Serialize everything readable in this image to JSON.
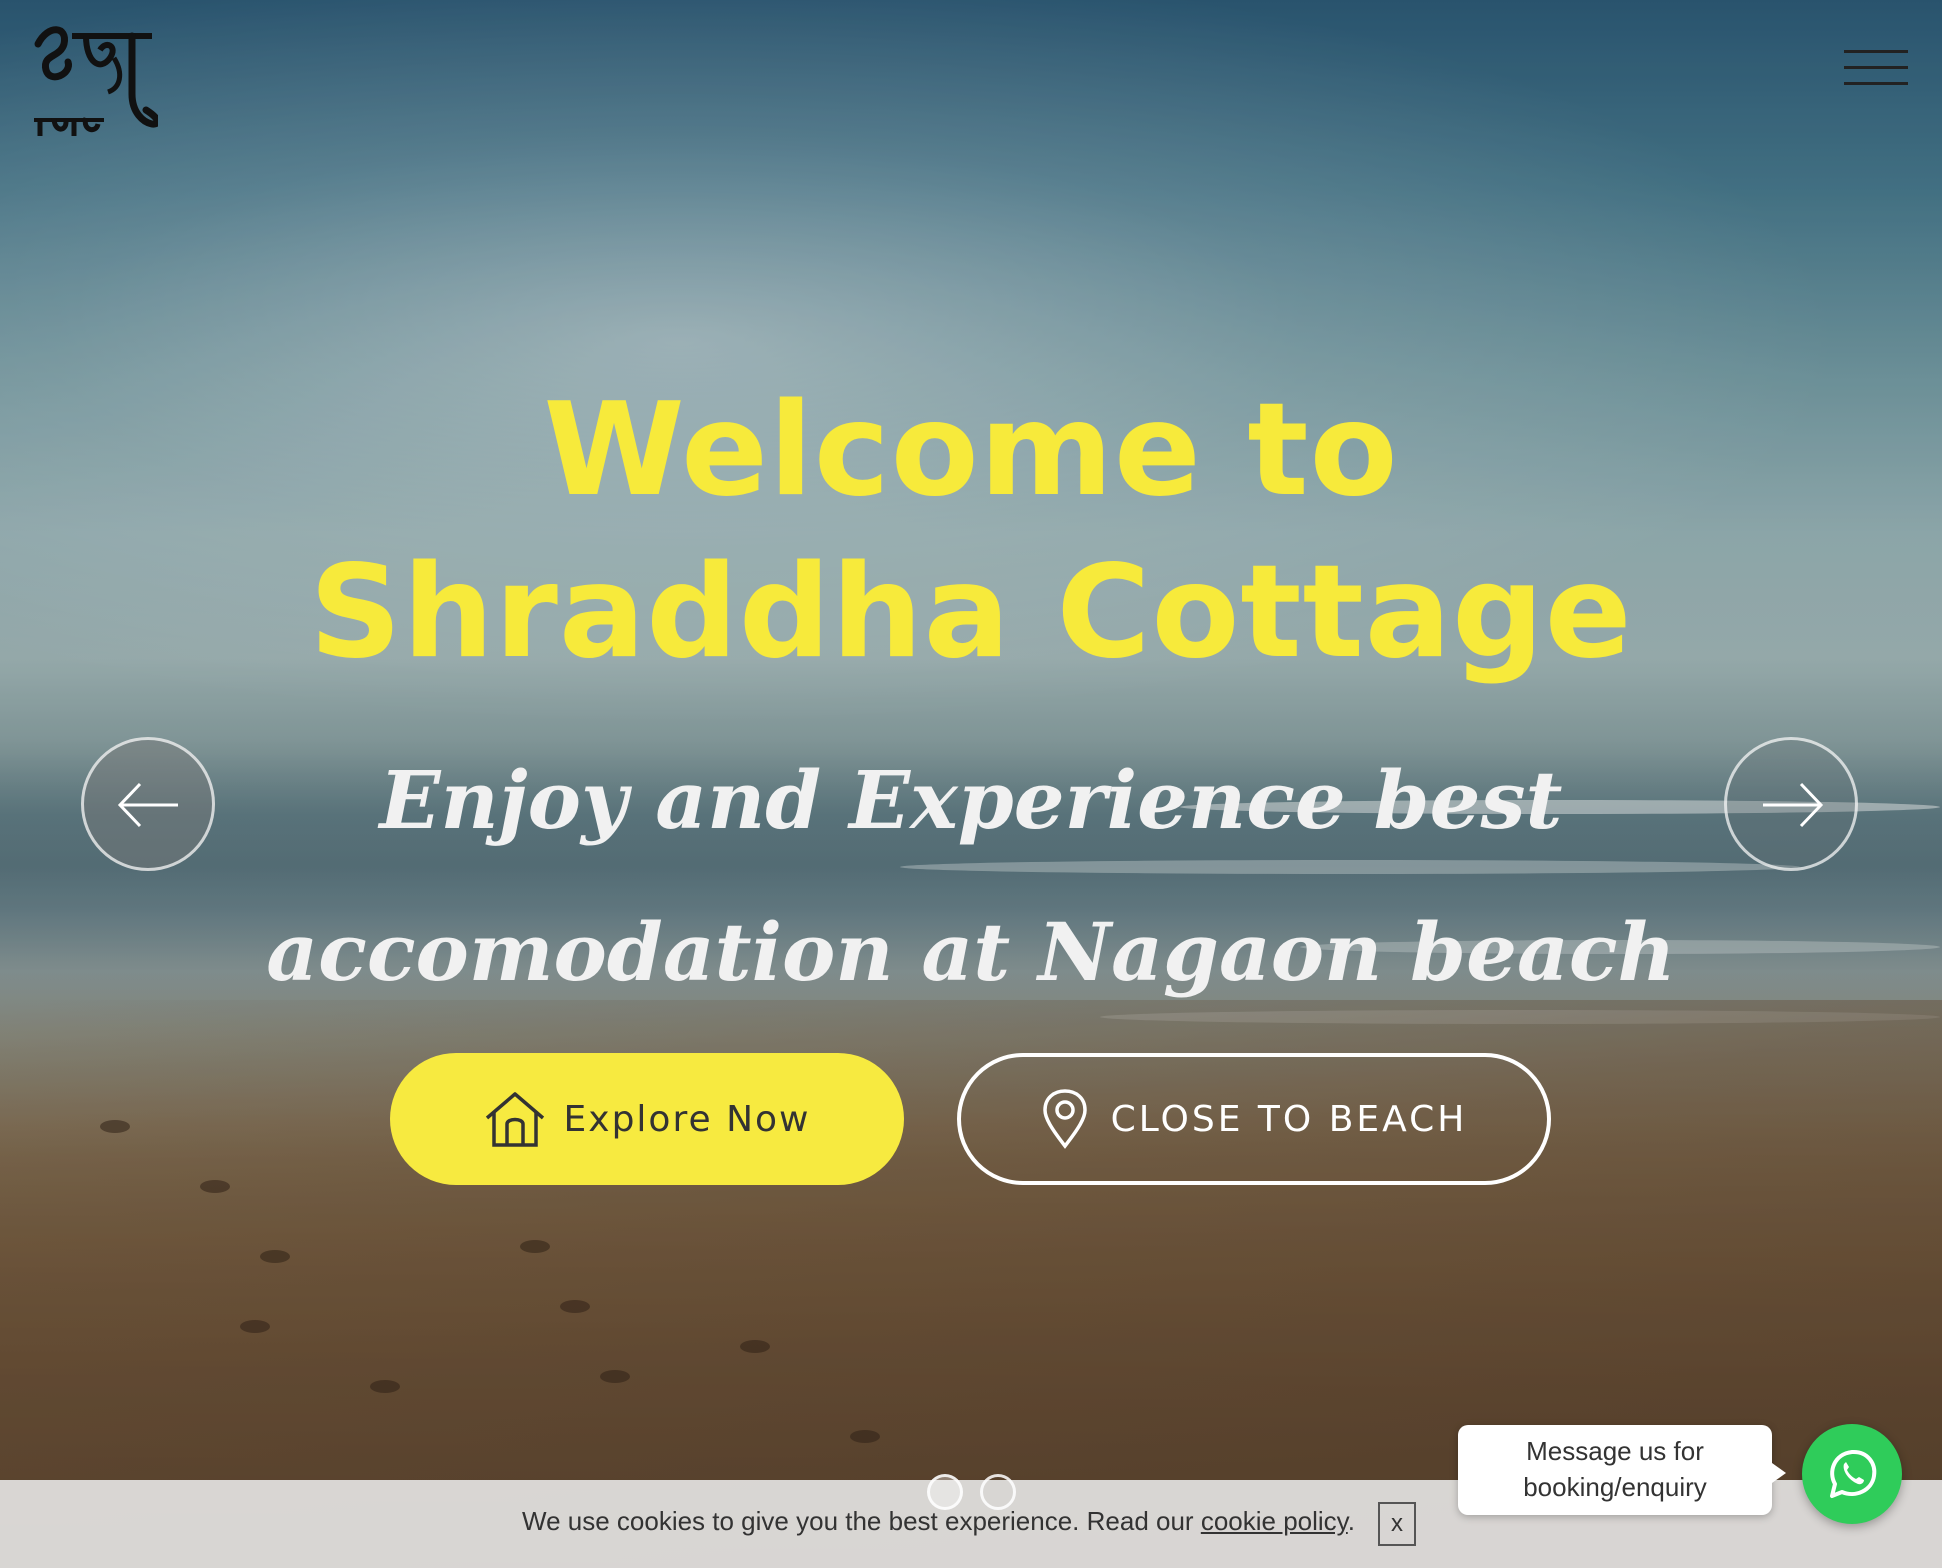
{
  "header": {
    "logo_icon": "shraddha-cottage-devanagari-logo",
    "menu_icon": "hamburger-menu-icon"
  },
  "hero": {
    "title_line1": "Welcome to",
    "title_line2": "Shraddha Cottage",
    "subtitle_line1": "Enjoy and Experience best",
    "subtitle_line2": "accomodation at Nagaon beach",
    "title_color": "#f7ea3b",
    "prev_icon": "arrow-left-icon",
    "next_icon": "arrow-right-icon"
  },
  "buttons": {
    "explore_label": "Explore Now",
    "explore_icon": "home-icon",
    "explore_color": "#f7ea40",
    "beach_label": "CLOSE TO BEACH",
    "beach_icon": "map-pin-icon"
  },
  "carousel": {
    "slide_count": 2,
    "active_index": 1
  },
  "cookie": {
    "text_before": "We use cookies to give you the best experience. Read our ",
    "link_label": "cookie policy",
    "text_after": ".",
    "close_label": "x"
  },
  "whatsapp": {
    "message_line1": "Message us for",
    "message_line2": "booking/enquiry",
    "icon": "whatsapp-icon",
    "color": "#2fcc5a"
  }
}
